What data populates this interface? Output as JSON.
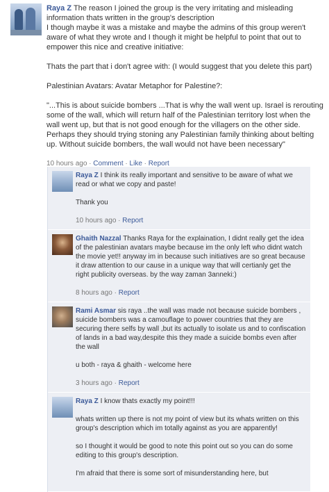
{
  "post": {
    "author": "Raya Z",
    "intro": "The reason I joined the group is the very irritating and misleading information thats written in the group's description",
    "paragraph1": "I though maybe it was a mistake and maybe the admins of this group weren't aware of what they wrote and I though it might be helpful to point that out to empower this nice and creative initiative:",
    "paragraph2": "Thats the part that i don't agree with: (I would suggest that you delete this part)",
    "paragraph3": "Palestinian Avatars: Avatar Metaphor for Palestine?:",
    "quote": "\"...This is about suicide bombers ...That is why the wall went up. Israel is rerouting some of the wall, which will return half of the Palestinian territory lost when the wall went up, but that is not good enough for the villagers on the other side. Perhaps they should trying stoning any Palestinian family thinking about belting up. Without suicide bombers, the wall would not have been necessary\"",
    "time": "10 hours ago",
    "comment_label": "Comment",
    "like_label": "Like",
    "report_label": "Report"
  },
  "comments": [
    {
      "author": "Raya Z",
      "text1": "I think its really important and sensitive to be aware of what we read or what we copy and paste!",
      "text2": "Thank you",
      "time": "10 hours ago",
      "report": "Report"
    },
    {
      "author": "Ghaith Nazzal",
      "text1": "Thanks Raya for the explaination, I didnt really get the idea of the palestinian avatars maybe because im the only left who didnt watch the movie yet!! anyway im in because such initiatives are so great because it draw attention to our cause in a unique way that will certianly get the right publicity overseas. by the way zaman 3anneki:)",
      "time": "8 hours ago",
      "report": "Report"
    },
    {
      "author": "Rami Asmar",
      "text1": "sis raya ..the wall was made not because suicide bombers , suicide bombers was a camouflage to power countries that they are securing there selfs by wall ,but its actually to isolate us and to confiscation of lands in a bad way,despite this they made a suicide bombs even after the wall",
      "text2": "u both - raya & ghaith - welcome here",
      "time": "3 hours ago",
      "report": "Report"
    },
    {
      "author": "Raya Z",
      "text1": "I know thats exactly my point!!!",
      "text2": "whats written up there is not my point of view but its whats written on this group's description which im totally against as you are apparently!",
      "text3": "so I thought it would be good to note this point out so you can do some editing to this group's description.",
      "text4": "I'm afraid that there is some sort of misunderstanding here, but"
    }
  ]
}
